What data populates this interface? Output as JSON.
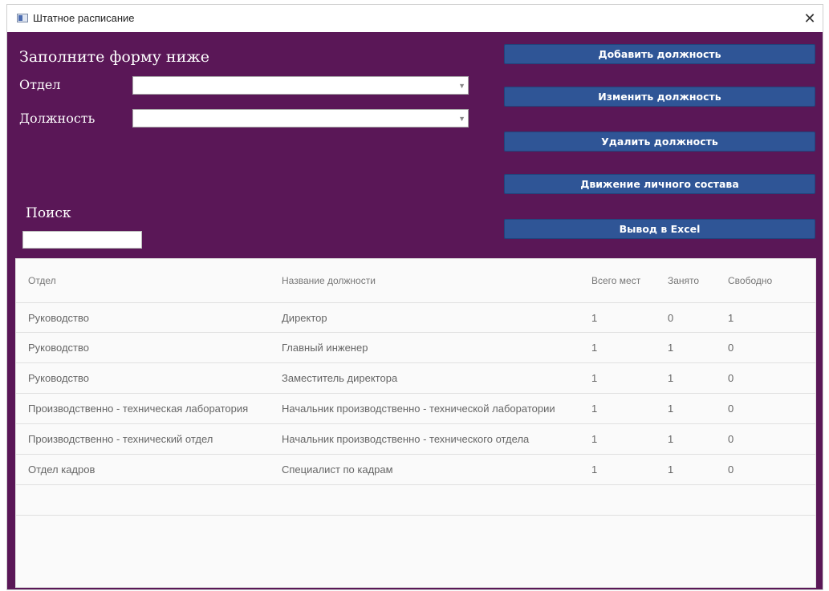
{
  "window": {
    "title": "Штатное расписание",
    "close_glyph": "✕"
  },
  "form": {
    "heading": "Заполните форму ниже",
    "department_label": "Отдел",
    "department_value": "",
    "position_label": "Должность",
    "position_value": "",
    "search_label": "Поиск",
    "search_value": ""
  },
  "buttons": {
    "add": "Добавить должность",
    "edit": "Изменить должность",
    "delete": "Удалить должность",
    "movement": "Движение личного состава",
    "export": "Вывод в Excel"
  },
  "table": {
    "headers": {
      "department": "Отдел",
      "position": "Название должности",
      "total": "Всего мест",
      "occupied": "Занято",
      "free": "Свободно"
    },
    "rows": [
      {
        "department": "Руководство",
        "position": "Директор",
        "total": "1",
        "occupied": "0",
        "free": "1"
      },
      {
        "department": "Руководство",
        "position": "Главный инженер",
        "total": "1",
        "occupied": "1",
        "free": "0"
      },
      {
        "department": "Руководство",
        "position": "Заместитель директора",
        "total": "1",
        "occupied": "1",
        "free": "0"
      },
      {
        "department": "Производственно - техническая лаборатория",
        "position": "Начальник производственно - технической лаборатории",
        "total": "1",
        "occupied": "1",
        "free": "0"
      },
      {
        "department": "Производственно - технический отдел",
        "position": "Начальник производственно - технического отдела",
        "total": "1",
        "occupied": "1",
        "free": "0"
      },
      {
        "department": "Отдел кадров",
        "position": "Специалист по кадрам",
        "total": "1",
        "occupied": "1",
        "free": "0"
      }
    ]
  },
  "colors": {
    "background": "#5a1757",
    "button": "#2f5596",
    "grid": "#fafafa"
  },
  "icons": {
    "app": "window-app-icon",
    "close": "close-icon",
    "combo": "chevron-down-icon"
  }
}
